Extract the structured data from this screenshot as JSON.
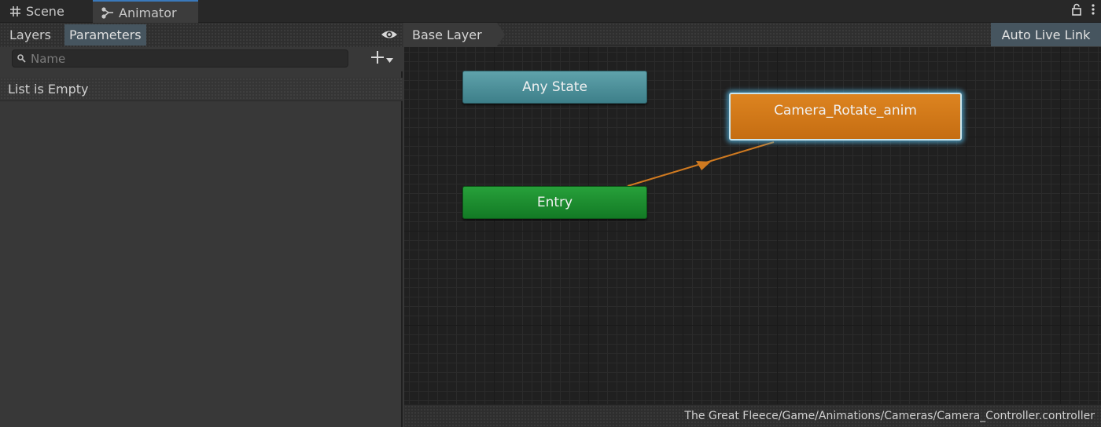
{
  "tabs": [
    {
      "label": "Scene",
      "icon": "grid-icon"
    },
    {
      "label": "Animator",
      "icon": "animator-icon"
    }
  ],
  "window_icons": [
    "lock-icon",
    "menu-dots-icon"
  ],
  "left_panel": {
    "subtabs": {
      "layers": "Layers",
      "parameters": "Parameters"
    },
    "search": {
      "placeholder": "Name",
      "value": ""
    },
    "list_message": "List is Empty"
  },
  "graph_header": {
    "breadcrumb": "Base Layer",
    "auto_live_link": "Auto Live Link"
  },
  "states": {
    "any_state": "Any State",
    "entry": "Entry",
    "camera": "Camera_Rotate_anim"
  },
  "colors": {
    "any_state": "#4f929b",
    "entry": "#1b8a2d",
    "default_state": "#d27a18",
    "transition": "#d07a20",
    "selection_glow": "#50aad2"
  },
  "status": {
    "path": "The Great Fleece/Game/Animations/Cameras/Camera_Controller.controller"
  }
}
